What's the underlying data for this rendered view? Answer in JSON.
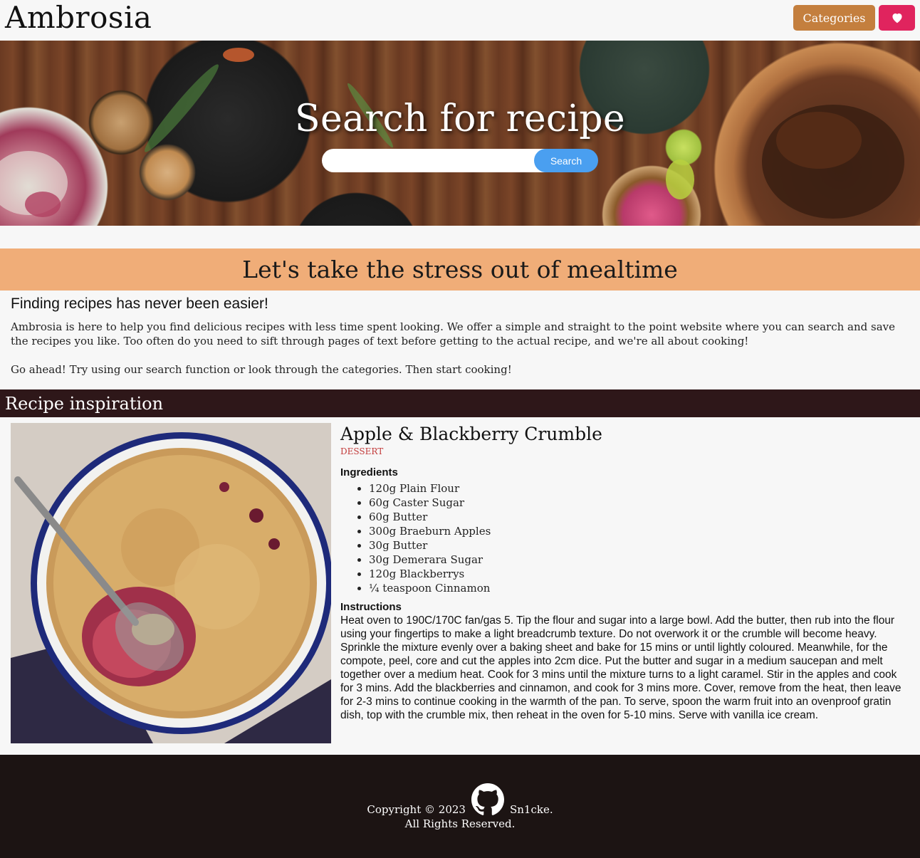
{
  "header": {
    "logo": "Ambrosia",
    "categories_label": "Categories",
    "favorites_icon": "heart-icon"
  },
  "hero": {
    "title": "Search for recipe",
    "search_placeholder": "",
    "search_button": "Search"
  },
  "tagline": "Let's take the stress out of mealtime",
  "intro": {
    "heading": "Finding recipes has never been easier!",
    "paragraph1": "Ambrosia is here to help you find delicious recipes with less time spent looking. We offer a simple and straight to the point website where you can search and save the recipes you like. Too often do you need to sift through pages of text before getting to the actual recipe, and we're all about cooking!",
    "paragraph2": "Go ahead! Try using our search function or look through the categories. Then start cooking!"
  },
  "section_title": "Recipe inspiration",
  "recipe": {
    "title": "Apple & Blackberry Crumble",
    "category": "DESSERT",
    "ingredients_heading": "Ingredients",
    "ingredients": [
      "120g Plain Flour",
      "60g Caster Sugar",
      "60g Butter",
      "300g Braeburn Apples",
      "30g Butter",
      "30g Demerara Sugar",
      "120g Blackberrys",
      "¼ teaspoon Cinnamon"
    ],
    "instructions_heading": "Instructions",
    "instructions": "Heat oven to 190C/170C fan/gas 5. Tip the flour and sugar into a large bowl. Add the butter, then rub into the flour using your fingertips to make a light breadcrumb texture. Do not overwork it or the crumble will become heavy. Sprinkle the mixture evenly over a baking sheet and bake for 15 mins or until lightly coloured. Meanwhile, for the compote, peel, core and cut the apples into 2cm dice. Put the butter and sugar in a medium saucepan and melt together over a medium heat. Cook for 3 mins until the mixture turns to a light caramel. Stir in the apples and cook for 3 mins. Add the blackberries and cinnamon, and cook for 3 mins more. Cover, remove from the heat, then leave for 2-3 mins to continue cooking in the warmth of the pan. To serve, spoon the warm fruit into an ovenproof gratin dish, top with the crumble mix, then reheat in the oven for 5-10 mins. Serve with vanilla ice cream."
  },
  "footer": {
    "copyright": "Copyright © 2023",
    "author": "Sn1cke.",
    "rights": "All Rights Reserved.",
    "github_icon": "github-icon"
  },
  "colors": {
    "categories_button": "#c47f3e",
    "favorites_button": "#e0245e",
    "search_button": "#4a9ff0",
    "tagline_bg": "#f0ad78",
    "section_bar_bg": "#2e1719",
    "footer_bg": "#1c1413",
    "category_text": "#c23a3a"
  }
}
